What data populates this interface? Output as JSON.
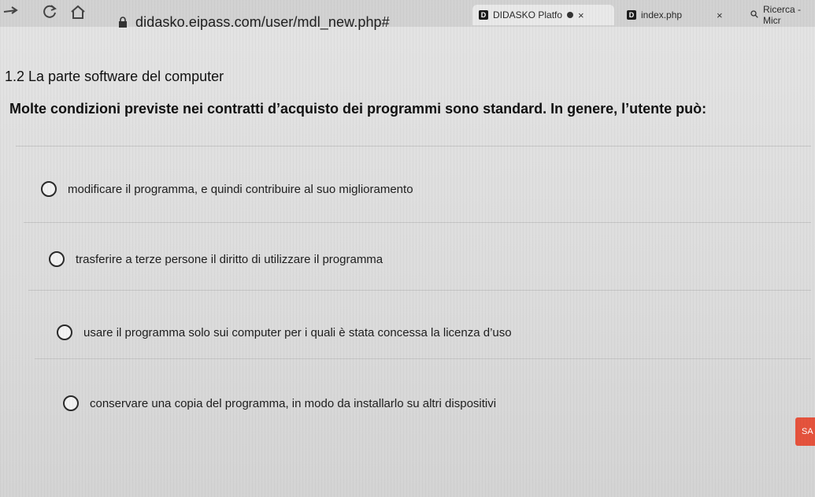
{
  "browser": {
    "tabs": [
      {
        "favicon": "D",
        "title": "DIDASKO Platfo",
        "recording": true,
        "close": "×"
      },
      {
        "favicon": "D",
        "title": "index.php",
        "close": "×"
      },
      {
        "icon": "search-icon",
        "title": "Ricerca - Micr"
      }
    ],
    "url": "didasko.eipass.com/user/mdl_new.php#"
  },
  "page": {
    "section_title": "1.2 La parte software del computer",
    "question": "Molte condizioni previste nei contratti d’acquisto dei programmi sono standard. In genere, l’utente può:",
    "options": [
      {
        "label": "modificare il programma, e quindi contribuire al suo miglioramento"
      },
      {
        "label": "trasferire a terze persone il diritto di utilizzare il programma"
      },
      {
        "label": "usare il programma solo sui computer per i quali è stata concessa la licenza d’uso"
      },
      {
        "label": "conservare una copia del programma, in modo da installarlo su altri dispositivi"
      }
    ],
    "save_label": "SA"
  },
  "colors": {
    "save_button": "#e5533d",
    "page_background": "#e4e4e4"
  }
}
